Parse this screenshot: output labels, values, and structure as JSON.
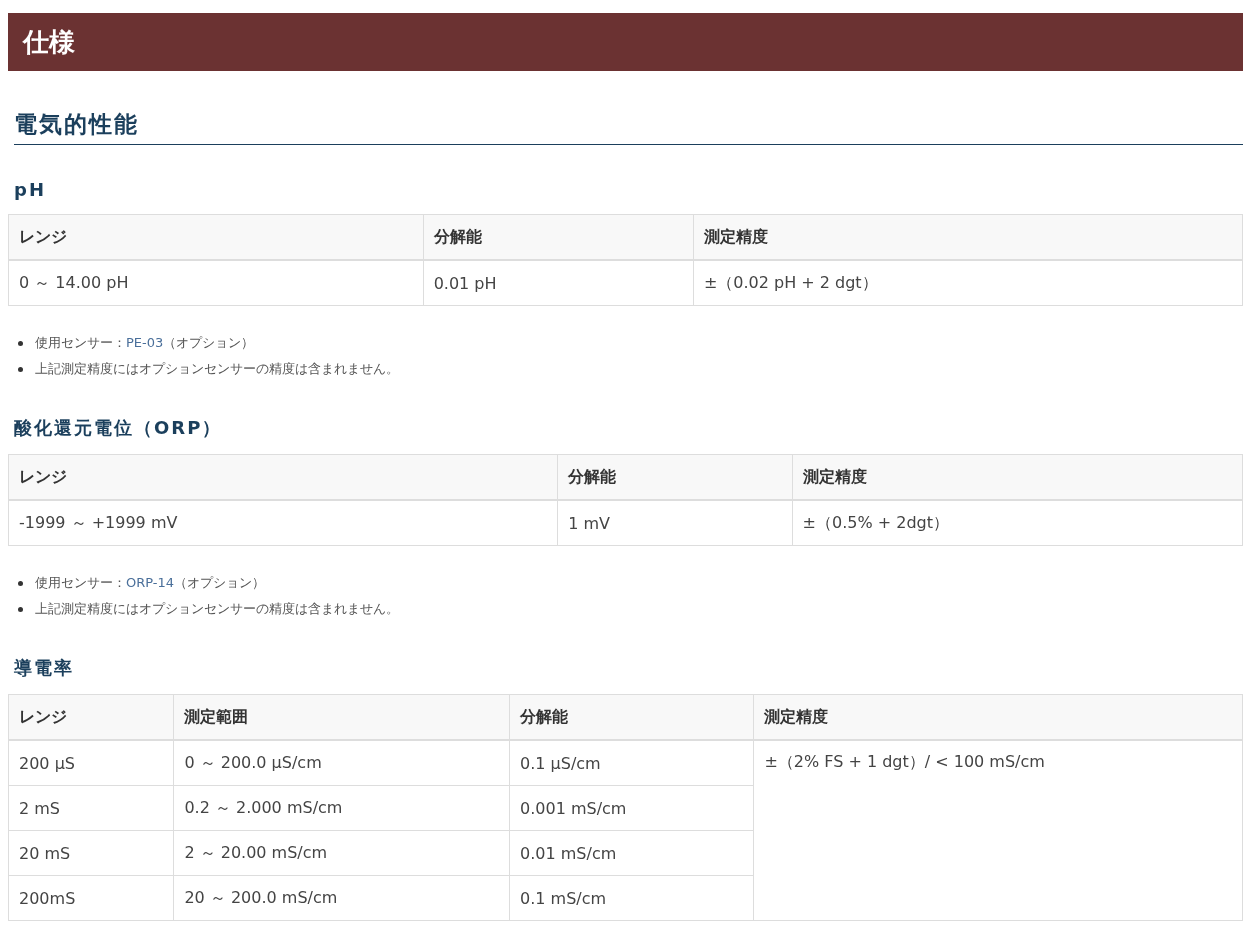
{
  "banner": {
    "title": "仕様"
  },
  "heading": "電気的性能",
  "sections": [
    {
      "title": "pH",
      "table": {
        "columns": [
          "レンジ",
          "分解能",
          "測定精度"
        ],
        "rows": [
          [
            "0 ～ 14.00 pH",
            "0.01 pH",
            "±（0.02 pH + 2 dgt）"
          ]
        ]
      },
      "notes": [
        {
          "kind": "link",
          "before": "使用センサー：",
          "link": "PE-03",
          "after": "（オプション）"
        },
        {
          "kind": "plain",
          "text": "上記測定精度にはオプションセンサーの精度は含まれません。"
        }
      ]
    },
    {
      "title": "酸化還元電位（ORP）",
      "table": {
        "columns": [
          "レンジ",
          "分解能",
          "測定精度"
        ],
        "rows": [
          [
            "-1999 ～ +1999 mV",
            "1 mV",
            "±（0.5% + 2dgt）"
          ]
        ]
      },
      "notes": [
        {
          "kind": "link",
          "before": "使用センサー：",
          "link": "ORP-14",
          "after": "（オプション）"
        },
        {
          "kind": "plain",
          "text": "上記測定精度にはオプションセンサーの精度は含まれません。"
        }
      ]
    },
    {
      "title": "導電率",
      "table": {
        "columns": [
          "レンジ",
          "測定範囲",
          "分解能",
          "測定精度"
        ],
        "rows": [
          [
            "200 μS",
            "0 ～ 200.0 μS/cm",
            "0.1 μS/cm"
          ],
          [
            "2 mS",
            "0.2 ～ 2.000 mS/cm",
            "0.001 mS/cm"
          ],
          [
            "20 mS",
            "2 ～ 20.00 mS/cm",
            "0.01 mS/cm"
          ],
          [
            "200mS",
            "20 ～ 200.0 mS/cm",
            "0.1 mS/cm"
          ]
        ],
        "shared_cell": "±（2% FS + 1 dgt）/ < 100 mS/cm"
      }
    }
  ]
}
